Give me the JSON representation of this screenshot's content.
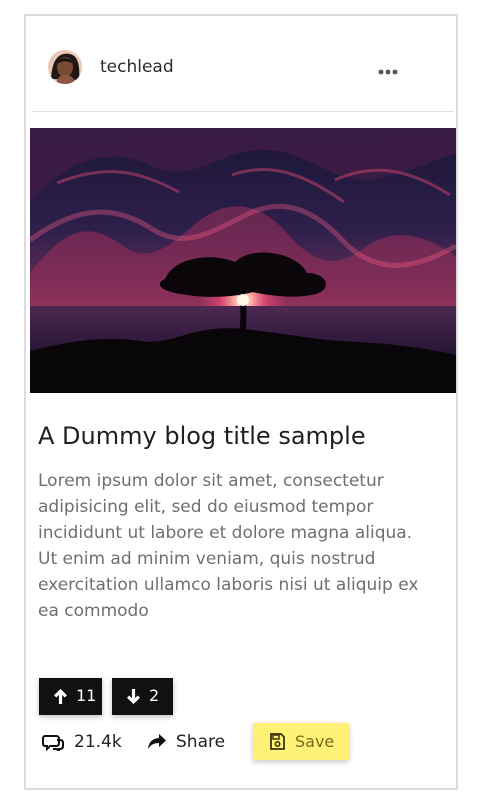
{
  "post": {
    "username": "techlead",
    "title": "A Dummy blog title sample",
    "body": "Lorem ipsum dolor sit amet, consectetur adipisicing elit, sed do eiusmod tempor incididunt ut labore et dolore magna aliqua. Ut enim ad minim veniam, quis nostrud exercitation ullamco laboris nisi ut aliquip ex ea commodo",
    "upvotes": "11",
    "downvotes": "2",
    "comments_count": "21.4k",
    "share_label": "Share",
    "save_label": "Save"
  },
  "icons": {
    "more": "more-icon",
    "upvote": "arrow-up-icon",
    "downvote": "arrow-down-icon",
    "comments": "comments-icon",
    "share": "share-icon",
    "save": "floppy-disk-icon"
  },
  "colors": {
    "card_border": "#dddddd",
    "vote_background": "#111111",
    "save_background": "#fff176",
    "body_text": "#6f6f6f"
  }
}
